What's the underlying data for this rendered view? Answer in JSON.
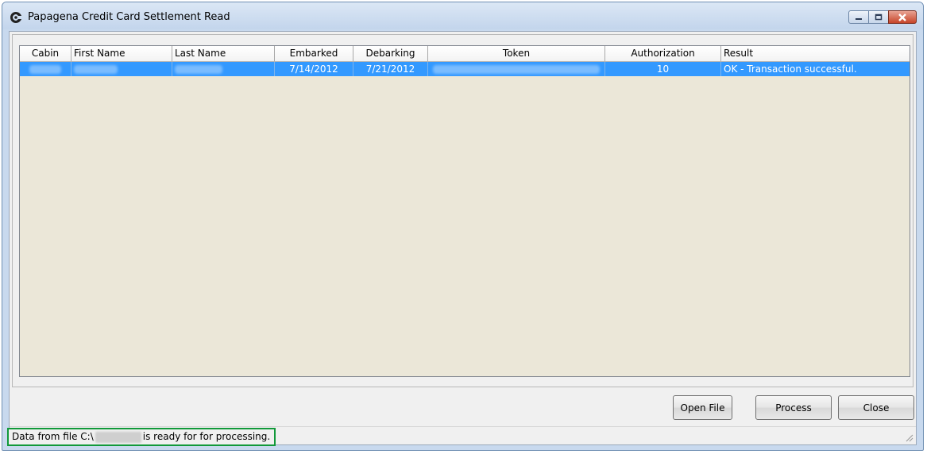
{
  "window": {
    "title": "Papagena Credit Card Settlement Read",
    "controls": {
      "minimize_icon": "minimize-icon",
      "maximize_icon": "restore-icon",
      "close_icon": "close-icon"
    }
  },
  "table": {
    "columns": [
      "Cabin",
      "First Name",
      "Last Name",
      "Embarked",
      "Debarking",
      "Token",
      "Authorization",
      "Result"
    ],
    "rows": [
      {
        "cabin": "",
        "first_name": "",
        "last_name": "",
        "embarked": "7/14/2012",
        "debarking": "7/21/2012",
        "token": "",
        "authorization": "10",
        "result": "OK - Transaction successful."
      }
    ],
    "selected_row_color": "#3399ff",
    "background_color": "#ebe7d8"
  },
  "buttons": {
    "open_file": "Open File",
    "process": "Process",
    "close": "Close"
  },
  "status": {
    "prefix": "Data from file C:\\",
    "suffix": "is ready for for processing.",
    "highlight_color": "#11993a"
  }
}
